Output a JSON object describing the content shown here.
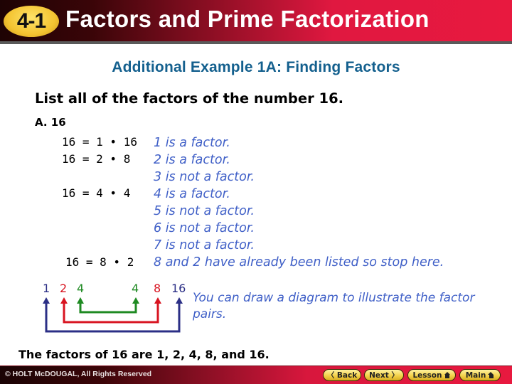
{
  "header": {
    "lesson_badge": "4-1",
    "title": "Factors and Prime Factorization"
  },
  "subtitle": "Additional Example 1A: Finding Factors",
  "prompt": "List all of the factors of the number 16.",
  "part_label": "A. 16",
  "equations": [
    "16 = 1 • 16",
    "16 = 2 • 8",
    "16 = 4 • 4",
    "16 = 8 • 2"
  ],
  "notes": [
    "1 is a factor.",
    "2 is a factor.",
    "3 is not a factor.",
    "4 is a factor.",
    "5 is not a factor.",
    "6 is not a factor.",
    "7 is not a factor.",
    "8 and 2 have already been listed so stop here."
  ],
  "diagram": {
    "numbers": [
      {
        "value": "1",
        "color": "#2b2f86"
      },
      {
        "value": "2",
        "color": "#d81420"
      },
      {
        "value": "4",
        "color": "#1e8a22"
      },
      {
        "value": "4",
        "color": "#1e8a22"
      },
      {
        "value": "8",
        "color": "#d81420"
      },
      {
        "value": "16",
        "color": "#2b2f86"
      }
    ],
    "pairs": [
      {
        "from": "1",
        "to": "16",
        "color": "#2b2f86"
      },
      {
        "from": "2",
        "to": "8",
        "color": "#d81420"
      },
      {
        "from": "4",
        "to": "4",
        "color": "#1e8a22"
      }
    ],
    "note": "You can draw a diagram to illustrate the factor pairs."
  },
  "conclusion": "The factors of 16 are 1, 2, 4, 8, and 16.",
  "footer": {
    "copyright": "© HOLT McDOUGAL, All Rights Reserved",
    "buttons": {
      "back": "〈 Back",
      "next": "Next 〉",
      "lesson": "Lesson",
      "main": "Main"
    }
  },
  "colors": {
    "subtitle": "#14608e",
    "note_text": "#3f5fc7",
    "header_red": "#e8193f",
    "badge_yellow": "#f4c431"
  }
}
